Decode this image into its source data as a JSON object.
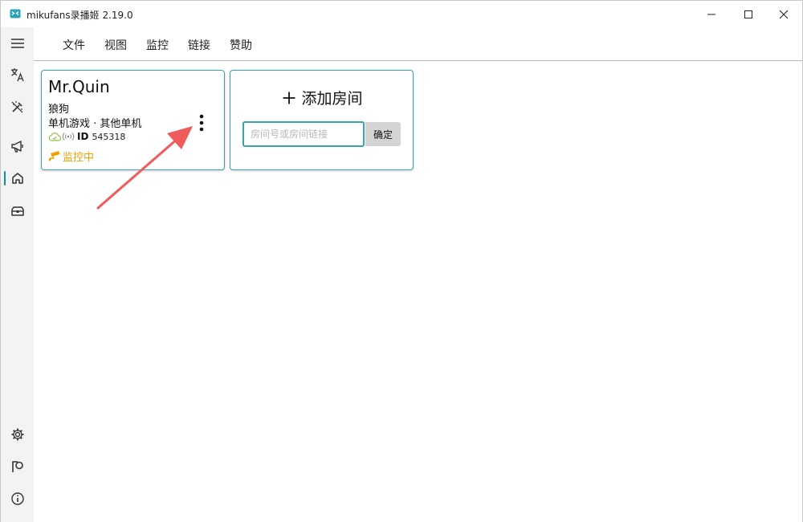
{
  "window": {
    "title": "mikufans录播姬 2.19.0",
    "icon": "app-logo-icon",
    "controls": [
      "minimize-icon",
      "maximize-icon",
      "close-icon"
    ]
  },
  "rail": {
    "items": [
      {
        "name": "menu-toggle",
        "icon": "hamburger-icon"
      },
      {
        "name": "language",
        "icon": "translate-icon"
      },
      {
        "name": "toolbox",
        "icon": "tools-icon"
      },
      {
        "name": "announcements",
        "icon": "megaphone-icon"
      },
      {
        "name": "home",
        "icon": "home-icon",
        "active": true
      },
      {
        "name": "toolbox-2",
        "icon": "toolbox-icon"
      }
    ],
    "bottom_items": [
      {
        "name": "settings",
        "icon": "gear-icon"
      },
      {
        "name": "sponsor",
        "icon": "patreon-icon"
      },
      {
        "name": "about",
        "icon": "info-icon"
      }
    ],
    "accent_color": "#0f8fa0"
  },
  "menu": {
    "items": [
      "文件",
      "视图",
      "监控",
      "链接",
      "赞助"
    ]
  },
  "room_card": {
    "name": "Mr.Quin",
    "anchor": "狼狗",
    "area": "单机游戏 · 其他单机",
    "id_label": "ID",
    "room_id": "545318",
    "status": "监控中",
    "status_color": "#f0a000"
  },
  "add_room": {
    "title": "添加房间",
    "title_icon": "plus-icon",
    "input_placeholder": "房间号或房间链接",
    "input_value": "",
    "confirm_label": "确定"
  },
  "annotation": {
    "arrow_color": "#f05a5a"
  },
  "colors": {
    "card_border": "#3aa3ac",
    "confirm_bg": "#d4d4d4"
  }
}
